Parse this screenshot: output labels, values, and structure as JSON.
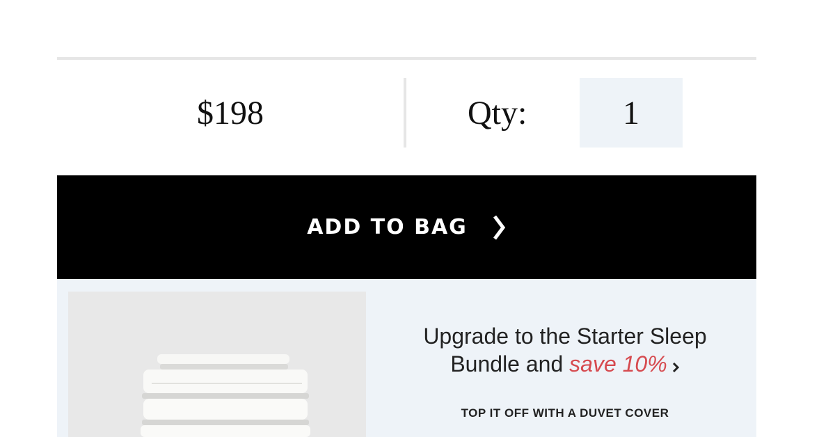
{
  "product": {
    "price": "$198",
    "qty_label": "Qty:",
    "qty_value": "1"
  },
  "actions": {
    "add_to_bag_label": "ADD TO BAG",
    "add_to_bag_icon": "chevron-right-icon"
  },
  "bundle": {
    "headline_line1": "Upgrade to the Starter Sleep",
    "headline_line2_prefix": "Bundle and ",
    "headline_save": "save 10%",
    "arrow_icon": "chevron-right-icon",
    "subtext": "TOP IT OFF WITH A DUVET COVER",
    "image_alt": "folded-white-sheets"
  },
  "colors": {
    "accent_red": "#d64a4f",
    "panel_bg": "#eef3f8",
    "button_bg": "#000000"
  }
}
